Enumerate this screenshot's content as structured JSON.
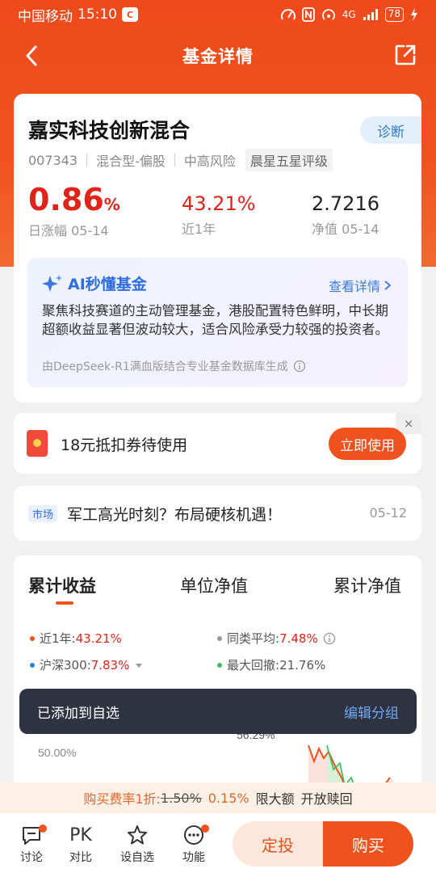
{
  "status_bar": {
    "carrier": "中国移动",
    "time": "15:10",
    "network": "4G",
    "battery": "78"
  },
  "nav": {
    "title": "基金详情"
  },
  "fund": {
    "name": "嘉实科技创新混合",
    "diagnose_label": "诊断",
    "code": "007343",
    "type": "混合型-偏股",
    "risk": "中高风险",
    "rating": "晨星五星评级",
    "daily_change": "0.86",
    "daily_change_unit": "%",
    "daily_change_label": "日涨幅 05-14",
    "year_return": "43.21%",
    "year_return_label": "近1年",
    "nav_value": "2.7216",
    "nav_label": "净值 05-14"
  },
  "ai": {
    "title": "AI秒懂基金",
    "more_label": "查看详情",
    "text": "聚焦科技赛道的主动管理基金，港股配置特色鲜明，中长期超额收益显著但波动较大，适合风险承受力较强的投资者。",
    "footnote": "由DeepSeek-R1满血版结合专业基金数据库生成"
  },
  "coupon": {
    "text": "18元抵扣券待使用",
    "button_label": "立即使用",
    "close_label": "×"
  },
  "news": {
    "tag": "市场",
    "title": "军工高光时刻？布局硬核机遇！",
    "date": "05-12"
  },
  "chart_tabs": [
    "累计收益",
    "单位净值",
    "累计净值"
  ],
  "chart_legend": {
    "fund_label": "近1年:",
    "fund_value": "43.21%",
    "peer_label": "同类平均:",
    "peer_value": "7.48%",
    "index_label": "沪深300:",
    "index_value": "7.83%",
    "drawdown_label": "最大回撤:",
    "drawdown_value": "21.76%"
  },
  "chart_data": {
    "type": "line",
    "visible_axis_labels": [
      "50.00%",
      "56.29%"
    ],
    "note": "chart mostly obscured by toast; only partial fund series visible"
  },
  "toast": {
    "text": "已添加到自选",
    "action": "编辑分组"
  },
  "fee": {
    "label": "购买费率1折:",
    "old_rate": "1.50%",
    "new_rate": "0.15%",
    "limit": "限大额",
    "redeem": "开放赎回"
  },
  "bottom": {
    "discuss": "讨论",
    "compare_icon": "PK",
    "compare": "对比",
    "watchlist": "设自选",
    "features": "功能",
    "fixed_invest": "定投",
    "buy": "购买"
  },
  "colors": {
    "brand": "#f0521d",
    "rise": "#e2231a",
    "ai_blue": "#2f6ee0"
  }
}
